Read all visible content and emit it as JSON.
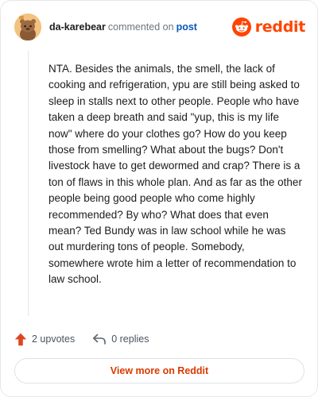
{
  "header": {
    "username": "da-karebear",
    "commented_text": "commented on",
    "post_link": "post",
    "brand": "reddit",
    "avatar_icon": "snoo-avatar-icon",
    "brand_icon": "reddit-logo-icon"
  },
  "comment": {
    "body": "NTA. Besides the animals, the smell, the lack of cooking and refrigeration, ypu are still being asked to sleep in stalls next to other people. People who have taken a deep breath and said \"yup, this is my life now\" where do your clothes go? How do you keep those from smelling? What about the bugs? Don't livestock have to get dewormed and crap? There is a ton of flaws in this whole plan. And as far as the other people being good people who come highly recommended? By who? What does that even mean? Ted Bundy was in law school while he was out murdering tons of people. Somebody, somewhere wrote him a letter of recommendation to law school."
  },
  "actions": {
    "upvotes": "2 upvotes",
    "replies": "0 replies",
    "upvote_icon": "upvote-arrow-icon",
    "reply_icon": "reply-arrow-icon"
  },
  "footer": {
    "view_more": "View more on Reddit"
  },
  "colors": {
    "brand": "#ff4500",
    "link": "#0a56b8",
    "view_more": "#d93a00"
  }
}
